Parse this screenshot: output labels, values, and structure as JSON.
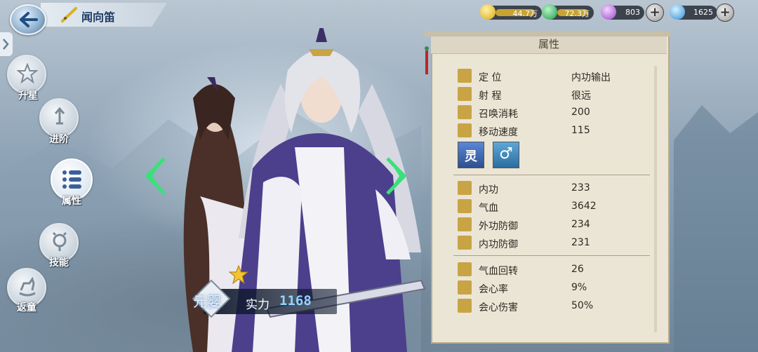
{
  "header": {
    "hero_name": "闻向笛"
  },
  "resources": [
    {
      "name": "gold",
      "icon": "gold-coin-icon",
      "value": "44.7万",
      "color": "#e8c53a"
    },
    {
      "name": "jade",
      "icon": "green-gem-icon",
      "value": "72.3万",
      "color": "#3ec26b"
    },
    {
      "name": "purple",
      "icon": "purple-crystal-icon",
      "value": "803",
      "color": "#b56cdc"
    },
    {
      "name": "diamond",
      "icon": "blue-diamond-icon",
      "value": "1625",
      "color": "#4fb3f5"
    }
  ],
  "side_menu": [
    {
      "label": "升星",
      "icon": "star-icon"
    },
    {
      "label": "进阶",
      "icon": "sword-upgrade-icon"
    },
    {
      "label": "属性",
      "icon": "attribute-list-icon",
      "active": true
    },
    {
      "label": "技能",
      "icon": "skill-icon"
    },
    {
      "label": "返童",
      "icon": "rocking-horse-icon"
    }
  ],
  "rank": {
    "title": "元婴",
    "power_label": "实力",
    "power_value": "1168"
  },
  "panel": {
    "title": "属性",
    "info": [
      {
        "label": "定 位",
        "value": "内功输出",
        "icon": "sword-icon"
      },
      {
        "label": "射 程",
        "value": "很远",
        "icon": "target-icon"
      },
      {
        "label": "召唤消耗",
        "value": "200",
        "icon": "drop-icon"
      },
      {
        "label": "移动速度",
        "value": "115",
        "icon": "boot-icon"
      }
    ],
    "badges": [
      {
        "icon": "spirit-class-icon",
        "text": "灵"
      },
      {
        "icon": "male-gender-icon",
        "text": "♂"
      }
    ],
    "stats": [
      {
        "label": "内功",
        "value": "233",
        "icon": "inner-power-icon"
      },
      {
        "label": "气血",
        "value": "3642",
        "icon": "heart-icon"
      },
      {
        "label": "外功防御",
        "value": "234",
        "icon": "outer-defense-icon"
      },
      {
        "label": "内功防御",
        "value": "231",
        "icon": "inner-defense-icon"
      }
    ],
    "stats2": [
      {
        "label": "气血回转",
        "value": "26",
        "icon": "heart-plus-icon"
      },
      {
        "label": "会心率",
        "value": "9%",
        "icon": "crit-rate-icon"
      },
      {
        "label": "会心伤害",
        "value": "50%",
        "icon": "crit-damage-icon"
      }
    ]
  }
}
